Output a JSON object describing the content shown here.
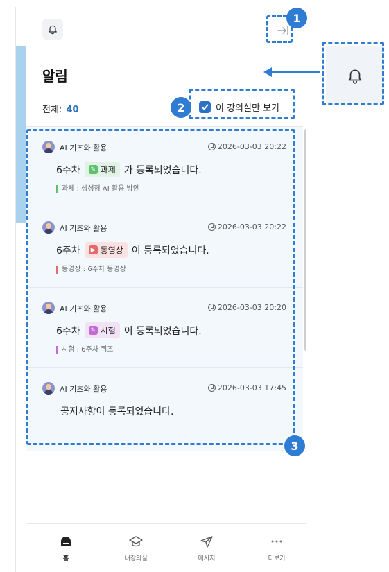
{
  "header": {
    "title": "알림"
  },
  "summary": {
    "total_label": "전체:",
    "total_count": "40"
  },
  "filter": {
    "label": "이 강의실만 보기",
    "checked": true
  },
  "notifications": [
    {
      "course": "AI 기초와 활용",
      "time": "2026-03-03 20:22",
      "week": "6주차",
      "type_label": "과제",
      "suffix": "가 등록되었습니다.",
      "detail": "과제 : 생성형 AI 활용 방안"
    },
    {
      "course": "AI 기초와 활용",
      "time": "2026-03-03 20:22",
      "week": "6주차",
      "type_label": "동영상",
      "suffix": "이 등록되었습니다.",
      "detail": "동영상 : 6주차 동영상"
    },
    {
      "course": "AI 기초와 활용",
      "time": "2026-03-03 20:20",
      "week": "6주차",
      "type_label": "시험",
      "suffix": "이 등록되었습니다.",
      "detail": "시험 : 6주차 퀴즈"
    },
    {
      "course": "AI 기초와 활용",
      "time": "2026-03-03 17:45",
      "message": "공지사항이 등록되었습니다."
    }
  ],
  "tabbar": {
    "home": "홈",
    "classroom": "내강의실",
    "message": "메시지",
    "more": "더보기"
  },
  "annotations": {
    "one": "1",
    "two": "2",
    "three": "3"
  },
  "colors": {
    "accent": "#2f7dd3",
    "assignment": "#5ec16e",
    "video": "#e66a6a",
    "exam": "#c36ad6"
  }
}
